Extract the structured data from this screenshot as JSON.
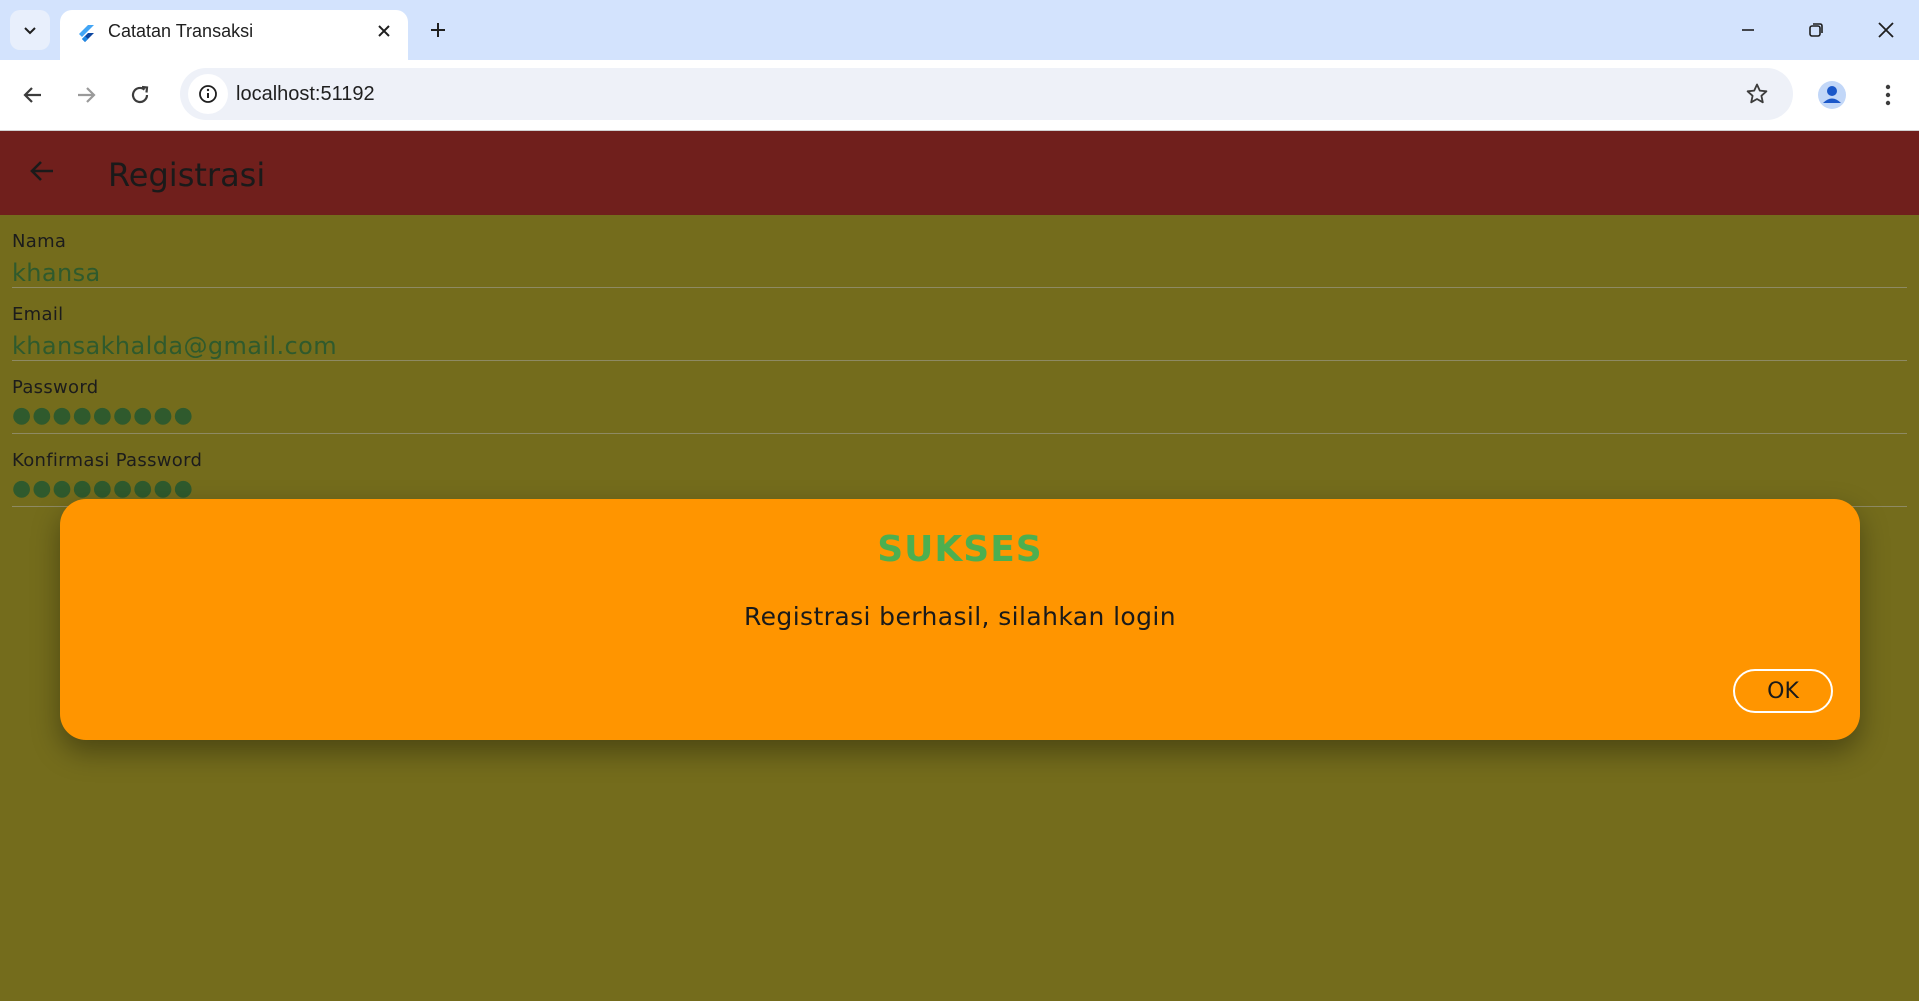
{
  "browser": {
    "tab_title": "Catatan Transaksi",
    "url": "localhost:51192"
  },
  "icons": {
    "tab_search": "chevron-down-icon",
    "favicon": "flutter-icon",
    "tab_close": "close-icon",
    "new_tab": "plus-icon",
    "back": "arrow-left-icon",
    "forward": "arrow-right-icon",
    "reload": "reload-icon",
    "site_info": "info-icon",
    "bookmark": "star-icon",
    "profile": "person-icon",
    "menu": "kebab-menu-icon"
  },
  "app": {
    "title": "Registrasi"
  },
  "form": {
    "fields": [
      {
        "label": "Nama",
        "value": "khansa"
      },
      {
        "label": "Email",
        "value": "khansakhalda@gmail.com"
      },
      {
        "label": "Password",
        "value": "●●●●●●●●●"
      },
      {
        "label": "Konfirmasi Password",
        "value": "●●●●●●●●●"
      }
    ]
  },
  "dialog": {
    "title": "SUKSES",
    "message": "Registrasi berhasil, silahkan login",
    "ok_label": "OK"
  },
  "colors": {
    "appbar": "#701f1c",
    "background": "#746c1c",
    "dialog": "#ff9500",
    "dialog_title": "#4caf50",
    "field_text": "#2f5a2d"
  }
}
